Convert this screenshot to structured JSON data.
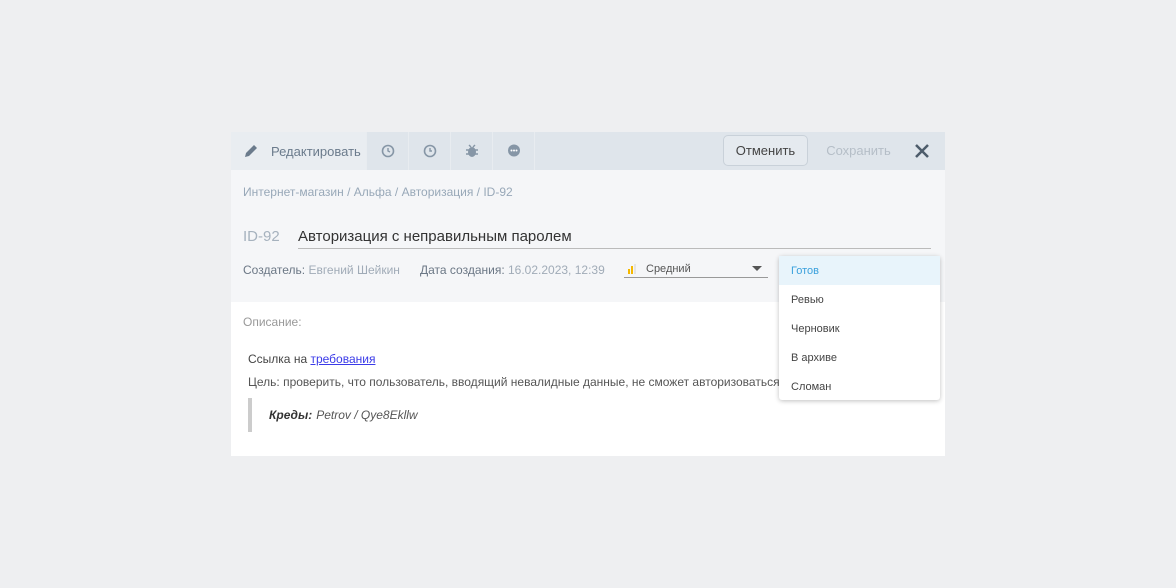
{
  "toolbar": {
    "edit_label": "Редактировать",
    "cancel_label": "Отменить",
    "save_label": "Сохранить"
  },
  "breadcrumb": "Интернет-магазин / Альфа / Авторизация / ID-92",
  "case": {
    "id": "ID-92",
    "title": "Авторизация с неправильным паролем"
  },
  "meta": {
    "creator_label": "Создатель:",
    "creator": "Евгений Шейкин",
    "date_label": "Дата создания:",
    "date": "16.02.2023, 12:39"
  },
  "priority": {
    "value": "Средний",
    "color": "#f5b800"
  },
  "description": {
    "label": "Описание:",
    "link_prefix": "Ссылка на",
    "link_text": "требования",
    "goal": "Цель: проверить, что пользователь, вводящий невалидные данные, не сможет авторизоваться",
    "creds_label": "Креды:",
    "creds": "Petrov / Qye8Ekllw"
  },
  "status_dropdown": {
    "options": [
      "Готов",
      "Ревью",
      "Черновик",
      "В архиве",
      "Сломан"
    ],
    "selected": "Готов"
  }
}
